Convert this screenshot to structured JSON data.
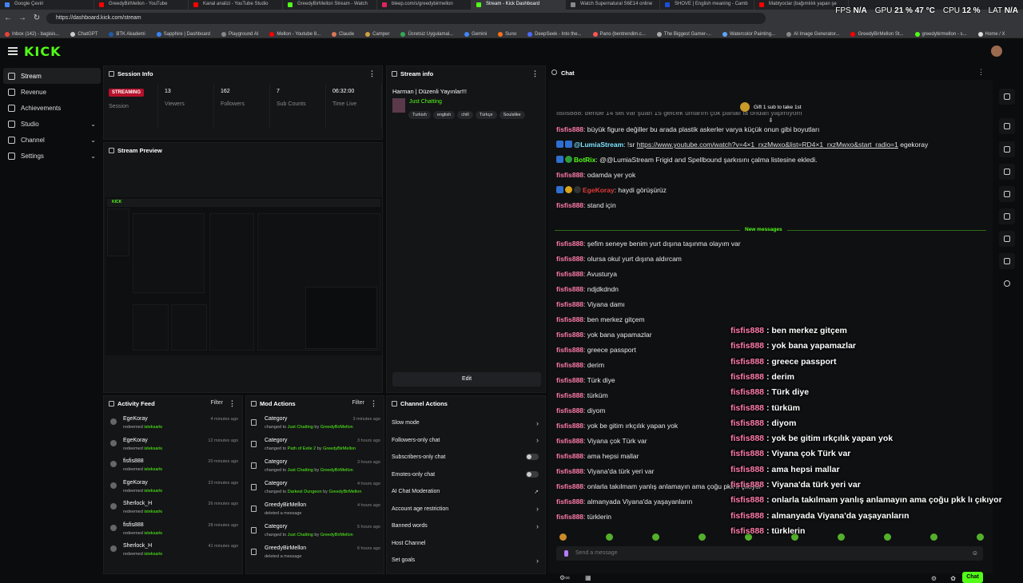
{
  "browser": {
    "tabs": [
      {
        "label": "Google Çeviri",
        "color": "#4285f4"
      },
      {
        "label": "GreedyBirMellon - YouTube",
        "color": "#ff0000"
      },
      {
        "label": "Kanal analizi - YouTube Studio",
        "color": "#ff0000"
      },
      {
        "label": "GreedyBirMellon Stream - Watch",
        "color": "#53fc18"
      },
      {
        "label": "bleep.com/s/greedybirmellon",
        "color": "#e0245e"
      },
      {
        "label": "Stream - Kick Dashboard",
        "color": "#53fc18"
      },
      {
        "label": "Watch Supernatural S6E14 online",
        "color": "#888888"
      },
      {
        "label": "SHOVE | English meaning - Camb",
        "color": "#1d4ed8"
      },
      {
        "label": "Mabtyoclar (bağımlılık yapan şe",
        "color": "#ff0000"
      }
    ],
    "url": "https://dashboard.kick.com/stream",
    "bookmarks": [
      {
        "label": "Inbox (142) - bagisis...",
        "color": "#ea4335"
      },
      {
        "label": "ChatGPT",
        "color": "#cccccc"
      },
      {
        "label": "BTK Akademi",
        "color": "#1e5aa8"
      },
      {
        "label": "Sapphire | Dashboard",
        "color": "#3b82f6"
      },
      {
        "label": "Playground AI",
        "color": "#888888"
      },
      {
        "label": "Mellon - Youtube 8...",
        "color": "#ff0000"
      },
      {
        "label": "Claude",
        "color": "#d97757"
      },
      {
        "label": "Camper",
        "color": "#d0a040"
      },
      {
        "label": "Ücretsiz Uygulamal...",
        "color": "#34a853"
      },
      {
        "label": "Gemini",
        "color": "#4285f4"
      },
      {
        "label": "Suno",
        "color": "#f97316"
      },
      {
        "label": "DeepSeek - Into the...",
        "color": "#4d6bfe"
      },
      {
        "label": "Pano (bentrendim.c...",
        "color": "#ff5555"
      },
      {
        "label": "The Biggest Gamer-...",
        "color": "#aaaaaa"
      },
      {
        "label": "Watercolor Painting...",
        "color": "#60a5fa"
      },
      {
        "label": "AI Image Generator...",
        "color": "#888888"
      },
      {
        "label": "GreedyBirMellon St...",
        "color": "#ff0000"
      },
      {
        "label": "greedybirmellon - s...",
        "color": "#53fc18"
      },
      {
        "label": "Home / X",
        "color": "#dddddd"
      }
    ]
  },
  "perf": {
    "fps_label": "FPS",
    "fps": "N/A",
    "gpu_label": "GPU",
    "gpu": "21 % 47 °C",
    "cpu_label": "CPU",
    "cpu": "12 %",
    "lat_label": "LAT",
    "lat": "N/A"
  },
  "app": {
    "logo": "KICK",
    "accent": "#53fc18"
  },
  "sidebar": {
    "items": [
      {
        "label": "Stream",
        "active": true,
        "chevron": ""
      },
      {
        "label": "Revenue",
        "active": false,
        "chevron": ""
      },
      {
        "label": "Achievements",
        "active": false,
        "chevron": ""
      },
      {
        "label": "Studio",
        "active": false,
        "chevron": "⌄"
      },
      {
        "label": "Channel",
        "active": false,
        "chevron": "⌄"
      },
      {
        "label": "Settings",
        "active": false,
        "chevron": "⌄"
      }
    ]
  },
  "session_info": {
    "title": "Session Info",
    "stats": [
      {
        "value": "STREAMING",
        "label": "Session"
      },
      {
        "value": "13",
        "label": "Viewers"
      },
      {
        "value": "162",
        "label": "Followers"
      },
      {
        "value": "7",
        "label": "Sub Counts"
      },
      {
        "value": "06:32:00",
        "label": "Time Live"
      }
    ]
  },
  "stream_info": {
    "title": "Stream info",
    "stream_title": "Harman | Düzenli Yayınlar!!!",
    "category": "Just Chatting",
    "tags": [
      "Turkish",
      "english",
      "chill",
      "Türkçe",
      "Soulslike"
    ],
    "edit_label": "Edit"
  },
  "stream_preview": {
    "title": "Stream Preview"
  },
  "activity_feed": {
    "title": "Activity Feed",
    "filter": "Filter",
    "items": [
      {
        "name": "EgeKoray",
        "action": "redeemed",
        "reward": "isteksarkı",
        "time": "4 minutes ago"
      },
      {
        "name": "EgeKoray",
        "action": "redeemed",
        "reward": "isteksarkı",
        "time": "12 minutes ago"
      },
      {
        "name": "fisfis888",
        "action": "redeemed",
        "reward": "isteksarkı",
        "time": "20 minutes ago"
      },
      {
        "name": "EgeKoray",
        "action": "redeemed",
        "reward": "isteksarkı",
        "time": "23 minutes ago"
      },
      {
        "name": "Sherlock_H",
        "action": "redeemed",
        "reward": "isteksarkı",
        "time": "26 minutes ago"
      },
      {
        "name": "fisfis888",
        "action": "redeemed",
        "reward": "isteksarkı",
        "time": "28 minutes ago"
      },
      {
        "name": "Sherlock_H",
        "action": "redeemed",
        "reward": "isteksarkı",
        "time": "41 minutes ago"
      }
    ]
  },
  "mod_actions": {
    "title": "Mod Actions",
    "filter": "Filter",
    "items": [
      {
        "name": "Category",
        "pre": "changed to",
        "hl": "Just Chatting",
        "by": "by",
        "user": "GreedyBirMellon",
        "time": "3 minutes ago"
      },
      {
        "name": "Category",
        "pre": "changed to",
        "hl": "Path of Exile 2",
        "by": "by",
        "user": "GreedyBirMellon",
        "time": "3 hours ago"
      },
      {
        "name": "Category",
        "pre": "changed to",
        "hl": "Just Chatting",
        "by": "by",
        "user": "GreedyBirMellon",
        "time": "3 hours ago"
      },
      {
        "name": "Category",
        "pre": "changed to",
        "hl": "Darkest Dungeon",
        "by": "by",
        "user": "GreedyBirMellon",
        "time": "4 hours ago"
      },
      {
        "name": "GreedyBirMellon",
        "pre": "deleted a message",
        "hl": "",
        "by": "",
        "user": "",
        "time": "4 hours ago"
      },
      {
        "name": "Category",
        "pre": "changed to",
        "hl": "Just Chatting",
        "by": "by",
        "user": "GreedyBirMellon",
        "time": "5 hours ago"
      },
      {
        "name": "GreedyBirMellon",
        "pre": "deleted a message",
        "hl": "",
        "by": "",
        "user": "",
        "time": "6 hours ago"
      }
    ]
  },
  "channel_actions": {
    "title": "Channel Actions",
    "items": [
      {
        "label": "Slow mode",
        "kind": "arrow"
      },
      {
        "label": "Followers-only chat",
        "kind": "arrow"
      },
      {
        "label": "Subscribers-only chat",
        "kind": "toggle"
      },
      {
        "label": "Emotes-only chat",
        "kind": "toggle"
      },
      {
        "label": "AI Chat Moderation",
        "kind": "ext"
      },
      {
        "label": "Account age restriction",
        "kind": "arrow"
      },
      {
        "label": "Banned words",
        "kind": "arrow"
      },
      {
        "label": "Host Channel",
        "kind": "none"
      },
      {
        "label": "Set goals",
        "kind": "arrow"
      }
    ]
  },
  "chat": {
    "title": "Chat",
    "gift_label": "Gift 1 sub to take 1st",
    "partial_line": "fisfis888: bende 14 set var şuan 15 gelcek umarım çok pahalı la ondan yapmıyom",
    "messages_before": [
      {
        "user": "fisfis888",
        "text": "büyük figure değiller bu arada plastik askerler varya küçük onun gibi boyutları",
        "kind": "user"
      },
      {
        "user": "@LumiaStream",
        "text": "!sr",
        "link": "https://www.youtube.com/watch?v=4×1_rxzMwxo&list=RD4×1_rxzMwxo&start_radio=1",
        "tail": "egekoray",
        "kind": "bot"
      },
      {
        "user": "BotRix",
        "text": "@@LumiaStream Frigid and Spellbound şarkısını çalma listesine ekledi.",
        "kind": "botrix"
      },
      {
        "user": "fisfis888",
        "text": "odamda yer yok",
        "kind": "user"
      },
      {
        "user": "EgeKoray",
        "text": "haydi görüşürüz",
        "kind": "ege"
      },
      {
        "user": "fisfis888",
        "text": "stand için",
        "kind": "user"
      }
    ],
    "new_messages_label": "New messages",
    "messages_after": [
      {
        "user": "fisfis888",
        "text": "şefim seneye benim yurt dışına taşınma olayım var"
      },
      {
        "user": "fisfis888",
        "text": "olursa okul yurt dışına aldırcam"
      },
      {
        "user": "fisfis888",
        "text": "Avusturya"
      },
      {
        "user": "fisfis888",
        "text": "ndjdkdndn"
      },
      {
        "user": "fisfis888",
        "text": "Viyana damı"
      },
      {
        "user": "fisfis888",
        "text": "ben merkez gitçem"
      },
      {
        "user": "fisfis888",
        "text": "yok bana yapamazlar"
      },
      {
        "user": "fisfis888",
        "text": "greece passport"
      },
      {
        "user": "fisfis888",
        "text": "derim"
      },
      {
        "user": "fisfis888",
        "text": "Türk diye"
      },
      {
        "user": "fisfis888",
        "text": "türküm"
      },
      {
        "user": "fisfis888",
        "text": "diyom"
      },
      {
        "user": "fisfis888",
        "text": "yok be gitim ırkçılık yapan yok"
      },
      {
        "user": "fisfis888",
        "text": "Viyana çok Türk var"
      },
      {
        "user": "fisfis888",
        "text": "ama hepsi mallar"
      },
      {
        "user": "fisfis888",
        "text": "Viyana'da türk yeri var"
      },
      {
        "user": "fisfis888",
        "text": "onlarla takılmam yanlış anlamayın ama çoğu pkk lı çıkıyor"
      },
      {
        "user": "fisfis888",
        "text": "almanyada Viyana'da yaşayanların"
      },
      {
        "user": "fisfis888",
        "text": "türklerin"
      }
    ],
    "input_placeholder": "Send a message",
    "send_label": "Chat"
  },
  "overlay": {
    "messages": [
      {
        "user": "fisfis888",
        "text": " : ben merkez gitçem"
      },
      {
        "user": "fisfis888",
        "text": " : yok bana yapamazlar"
      },
      {
        "user": "fisfis888",
        "text": " : greece passport"
      },
      {
        "user": "fisfis888",
        "text": " : derim"
      },
      {
        "user": "fisfis888",
        "text": " : Türk diye"
      },
      {
        "user": "fisfis888",
        "text": " : türküm"
      },
      {
        "user": "fisfis888",
        "text": " : diyom"
      },
      {
        "user": "fisfis888",
        "text": " : yok be gitim ırkçılık yapan yok"
      },
      {
        "user": "fisfis888",
        "text": " : Viyana çok Türk var"
      },
      {
        "user": "fisfis888",
        "text": " : ama hepsi mallar"
      },
      {
        "user": "fisfis888",
        "text": " : Viyana'da türk yeri var"
      },
      {
        "user": "fisfis888",
        "text": " : onlarla takılmam yanlış anlamayın ama çoğu pkk lı çıkıyor"
      },
      {
        "user": "fisfis888",
        "text": " : almanyada Viyana'da yaşayanların"
      },
      {
        "user": "fisfis888",
        "text": " : türklerin"
      }
    ]
  }
}
